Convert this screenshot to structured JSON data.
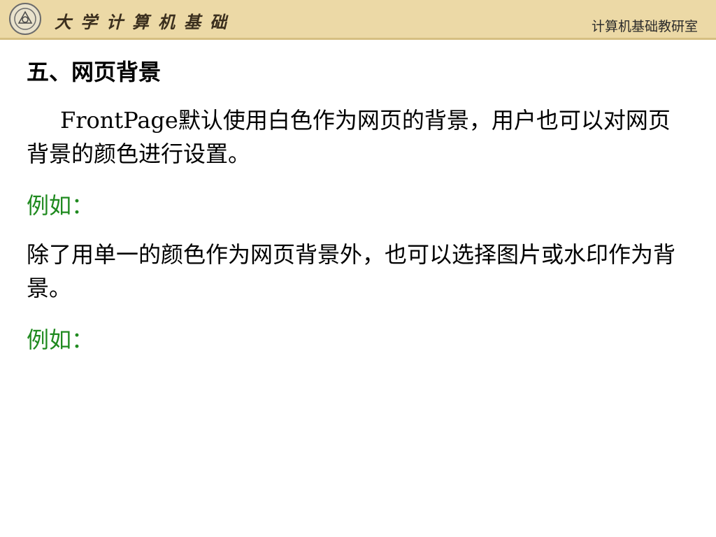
{
  "header": {
    "course_title": "大学计算机基础",
    "department": "计算机基础教研室"
  },
  "slide": {
    "heading": "五、网页背景",
    "para1": "FrontPage默认使用白色作为网页的背景，用户也可以对网页背景的颜色进行设置。",
    "example1": "例如：",
    "para2": "除了用单一的颜色作为网页背景外，也可以选择图片或水印作为背景。",
    "example2": "例如："
  },
  "colors": {
    "header_bg": "#ecd9a6",
    "example_text": "#1f8a1f"
  }
}
